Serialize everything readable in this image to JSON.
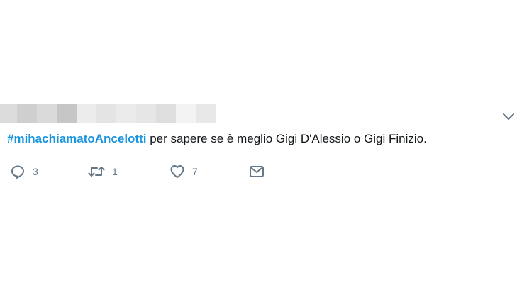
{
  "tweet": {
    "hashtag": "#mihachiamatoAncelotti",
    "text": " per sapere se è meglio Gigi D'Alessio o Gigi Finizio.",
    "reply_count": "3",
    "retweet_count": "1",
    "like_count": "7"
  },
  "icons": {
    "caret": "chevron-down-icon",
    "reply": "reply-icon",
    "retweet": "retweet-icon",
    "like": "heart-icon",
    "dm": "envelope-icon"
  },
  "colors": {
    "hashtag": "#1b95e0",
    "text": "#14171a",
    "icon": "#657786"
  }
}
